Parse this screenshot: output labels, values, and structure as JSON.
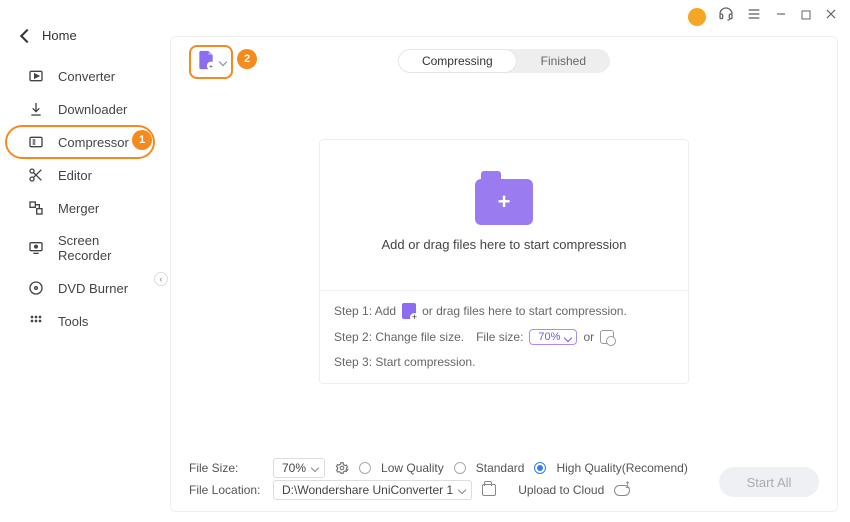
{
  "titlebar": {
    "avatar_glyph": ""
  },
  "home": {
    "label": "Home"
  },
  "sidebar": {
    "items": [
      {
        "label": "Converter",
        "icon": "converter-icon"
      },
      {
        "label": "Downloader",
        "icon": "download-icon"
      },
      {
        "label": "Compressor",
        "icon": "compressor-icon",
        "active": true
      },
      {
        "label": "Editor",
        "icon": "scissors-icon"
      },
      {
        "label": "Merger",
        "icon": "merger-icon"
      },
      {
        "label": "Screen Recorder",
        "icon": "screen-recorder-icon"
      },
      {
        "label": "DVD Burner",
        "icon": "disc-icon"
      },
      {
        "label": "Tools",
        "icon": "grid-icon"
      }
    ]
  },
  "callouts": {
    "one": "1",
    "two": "2"
  },
  "tabs": {
    "compressing": "Compressing",
    "finished": "Finished",
    "active": "compressing"
  },
  "drop": {
    "headline": "Add or drag files here to start compression",
    "step1_prefix": "Step 1: Add",
    "step1_suffix": "or drag files here to start compression.",
    "step2_prefix": "Step 2: Change file size.",
    "step2_filesize_label": "File size:",
    "step2_pct": "70%",
    "step2_or": "or",
    "step3": "Step 3: Start compression."
  },
  "footer": {
    "filesize_label": "File Size:",
    "filesize_value": "70%",
    "quality": {
      "low": "Low Quality",
      "standard": "Standard",
      "high": "High Quality(Recomend)",
      "selected": "high"
    },
    "location_label": "File Location:",
    "location_value": "D:\\Wondershare UniConverter 1",
    "upload_cloud": "Upload to Cloud",
    "start_all": "Start All"
  }
}
